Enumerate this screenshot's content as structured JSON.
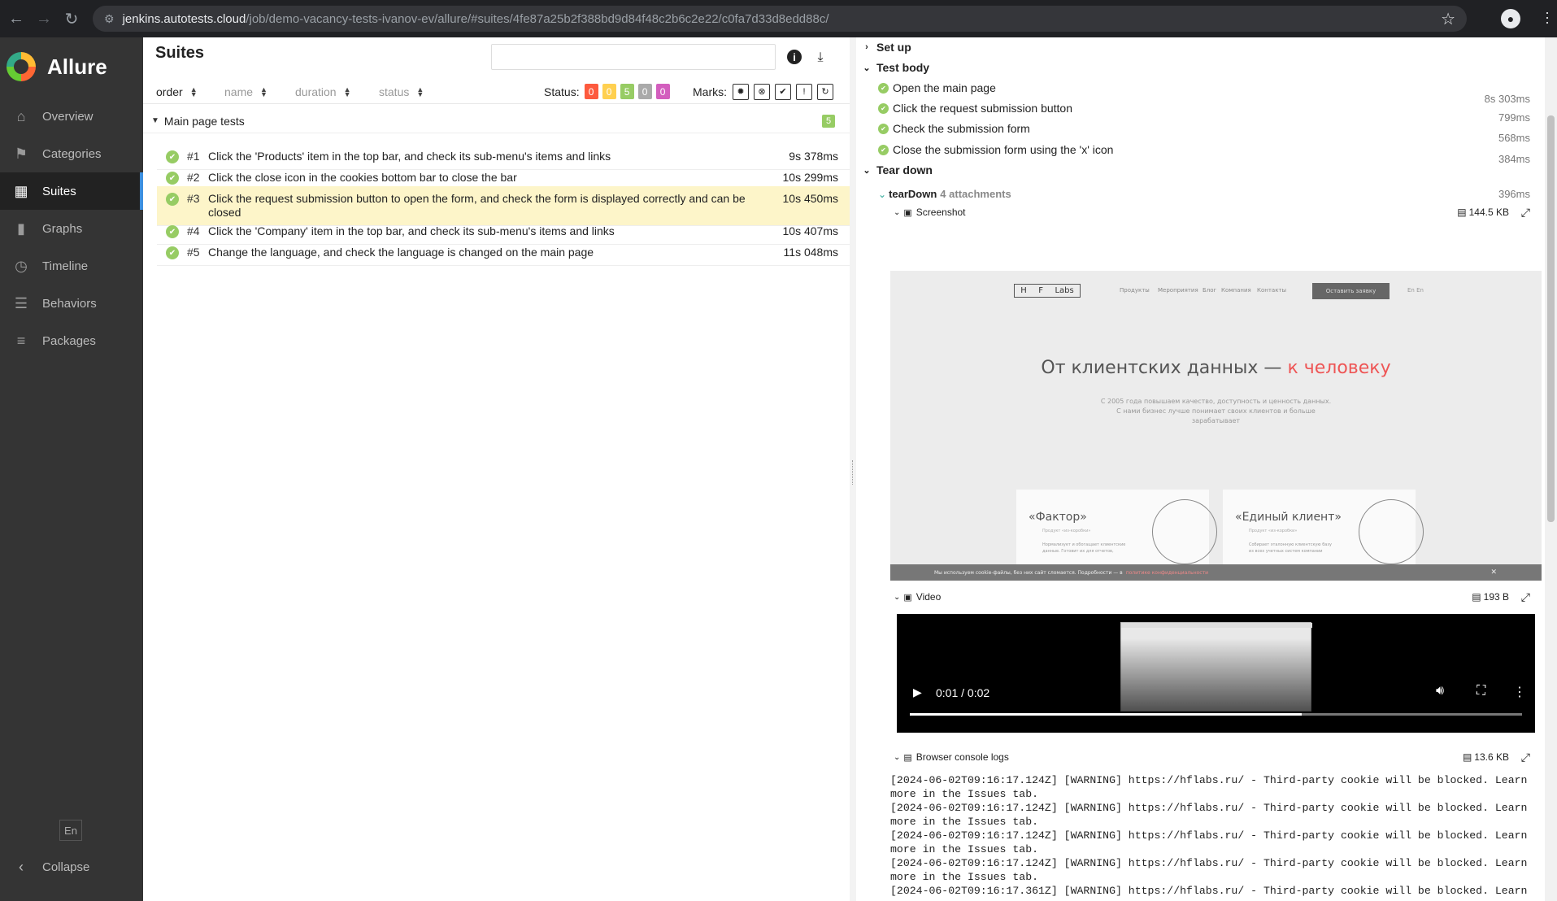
{
  "browser": {
    "url_host": "jenkins.autotests.cloud",
    "url_path": "/job/demo-vacancy-tests-ivanov-ev/allure/#suites/4fe87a25b2f388bd9d84f48c2b6c2e22/c0fa7d33d8edd88c/"
  },
  "sidebar": {
    "brand": "Allure",
    "items": [
      {
        "label": "Overview",
        "icon": "home-icon",
        "glyph": "⌂"
      },
      {
        "label": "Categories",
        "icon": "flag-icon",
        "glyph": "⚑"
      },
      {
        "label": "Suites",
        "icon": "briefcase-icon",
        "glyph": "▦",
        "active": true
      },
      {
        "label": "Graphs",
        "icon": "bar-chart-icon",
        "glyph": "▮"
      },
      {
        "label": "Timeline",
        "icon": "clock-icon",
        "glyph": "◷"
      },
      {
        "label": "Behaviors",
        "icon": "list-icon",
        "glyph": "☰"
      },
      {
        "label": "Packages",
        "icon": "align-left-icon",
        "glyph": "≡"
      }
    ],
    "language": "En",
    "collapse": "Collapse"
  },
  "suites": {
    "title": "Suites",
    "columns": {
      "order": "order",
      "name": "name",
      "duration": "duration",
      "status": "status"
    },
    "status_label": "Status:",
    "status_counts": [
      {
        "value": "0",
        "color": "#fd5a3e",
        "name": "failed"
      },
      {
        "value": "0",
        "color": "#ffd050",
        "name": "broken"
      },
      {
        "value": "5",
        "color": "#97cc64",
        "name": "passed"
      },
      {
        "value": "0",
        "color": "#aaaaaa",
        "name": "skipped"
      },
      {
        "value": "0",
        "color": "#d35ebe",
        "name": "unknown"
      }
    ],
    "marks_label": "Marks:",
    "group": {
      "label": "Main page tests",
      "count": "5"
    },
    "tests": [
      {
        "num": "#1",
        "name": "Click the 'Products' item in the top bar, and check its sub-menu's items and links",
        "duration": "9s 378ms"
      },
      {
        "num": "#2",
        "name": "Click the close icon in the cookies bottom bar to close the bar",
        "duration": "10s 299ms"
      },
      {
        "num": "#3",
        "name": "Click the request submission button to open the form, and check the form is displayed correctly and can be closed",
        "duration": "10s 450ms"
      },
      {
        "num": "#4",
        "name": "Click the 'Company' item in the top bar, and check its sub-menu's items and links",
        "duration": "10s 407ms"
      },
      {
        "num": "#5",
        "name": "Change the language, and check the language is changed on the main page",
        "duration": "11s 048ms"
      }
    ]
  },
  "detail": {
    "setup": "Set up",
    "test_body": "Test body",
    "steps": [
      {
        "name": "Open the main page",
        "duration": "8s 303ms"
      },
      {
        "name": "Click the request submission button",
        "duration": "799ms"
      },
      {
        "name": "Check the submission form",
        "duration": "568ms"
      },
      {
        "name": "Close the submission form using the 'x' icon",
        "duration": "384ms"
      }
    ],
    "teardown": "Tear down",
    "teardown_step": {
      "name": "tearDown",
      "attachments": "4 attachments",
      "duration": "396ms"
    },
    "attachments": {
      "screenshot": {
        "name": "Screenshot",
        "size": "144.5 KB"
      },
      "video": {
        "name": "Video",
        "size": "193 B",
        "time": "0:01 / 0:02",
        "progress": 0.64
      },
      "logs": {
        "name": "Browser console logs",
        "size": "13.6 KB"
      }
    },
    "shot": {
      "logo": [
        "H",
        "F",
        "Labs"
      ],
      "menu": [
        "Продукты",
        "Мероприятия",
        "Блог",
        "Компания",
        "Контакты"
      ],
      "button": "Оставить заявку",
      "lang": "En En",
      "hero_a": "От клиентских данных — ",
      "hero_b": "к человеку",
      "sub1": "С 2005 года повышаем качество, доступность и ценность данных.",
      "sub2": "С нами бизнес лучше понимает своих клиентов и больше",
      "sub3": "зарабатывает",
      "card1": {
        "title": "«Фактор»",
        "sub": "Продукт «из-коробки»",
        "d1": "Нормализует и обогащает клиентские",
        "d2": "данные. Готовит их для отчетов,"
      },
      "card2": {
        "title": "«Единый клиент»",
        "sub": "Продукт «из-коробки»",
        "d1": "Собирает эталонную клиентскую базу",
        "d2": "из всех учетных систем компании"
      },
      "cookie": "Мы используем cookie-файлы, без них сайт сломается. Подробности — в",
      "cookie_link": "политике конфиденциальности"
    },
    "log_lines": [
      "[2024-06-02T09:16:17.124Z] [WARNING] https://hflabs.ru/ - Third-party cookie will be blocked. Learn",
      "more in the Issues tab.",
      "[2024-06-02T09:16:17.124Z] [WARNING] https://hflabs.ru/ - Third-party cookie will be blocked. Learn",
      "more in the Issues tab.",
      "[2024-06-02T09:16:17.124Z] [WARNING] https://hflabs.ru/ - Third-party cookie will be blocked. Learn",
      "more in the Issues tab.",
      "[2024-06-02T09:16:17.124Z] [WARNING] https://hflabs.ru/ - Third-party cookie will be blocked. Learn",
      "more in the Issues tab.",
      "[2024-06-02T09:16:17.361Z] [WARNING] https://hflabs.ru/ - Third-party cookie will be blocked. Learn"
    ]
  }
}
